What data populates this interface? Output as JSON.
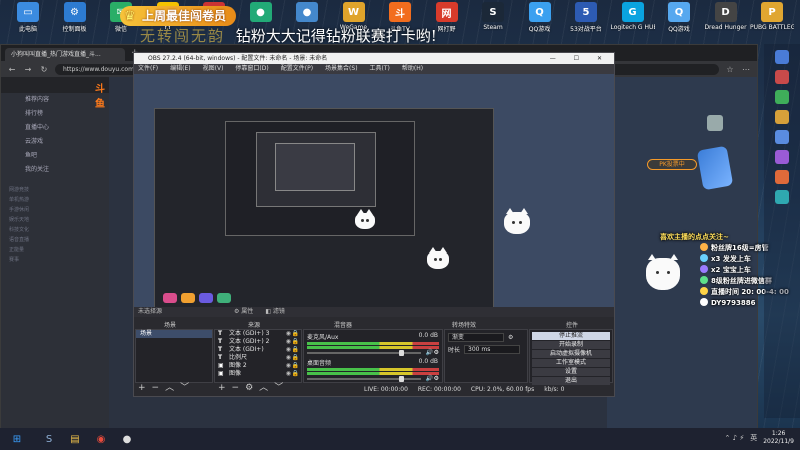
{
  "desktop": {
    "icons": [
      {
        "label": "此电脑",
        "icon": "computer-icon",
        "color": "#3b8be0",
        "glyph": "▭"
      },
      {
        "label": "控制面板",
        "icon": "control-panel-icon",
        "color": "#2d7bd1",
        "glyph": "⚙"
      },
      {
        "label": "微信",
        "icon": "wechat-icon",
        "color": "#2aae67",
        "glyph": "✉"
      },
      {
        "label": "YY",
        "icon": "yy-icon",
        "color": "#f5c200",
        "glyph": "Y"
      },
      {
        "label": "",
        "icon": "app-icon",
        "color": "#c33",
        "glyph": "●"
      },
      {
        "label": "",
        "icon": "app-icon",
        "color": "#2a7",
        "glyph": "●"
      },
      {
        "label": "",
        "icon": "app-icon",
        "color": "#48c",
        "glyph": "●"
      },
      {
        "label": "WeGame",
        "icon": "wegame-icon",
        "color": "#e0a42b",
        "glyph": "W"
      },
      {
        "label": "斗鱼TV",
        "icon": "douyu-icon",
        "color": "#f26d1e",
        "glyph": "斗"
      },
      {
        "label": "网打野",
        "icon": "game-icon",
        "color": "#d83b2b",
        "glyph": "网"
      },
      {
        "label": "Steam",
        "icon": "steam-icon",
        "color": "#1b2838",
        "glyph": "S"
      },
      {
        "label": "QQ游戏",
        "icon": "qq-game-icon",
        "color": "#3ba0f0",
        "glyph": "Q"
      },
      {
        "label": "53对战平台",
        "icon": "battle-platform-icon",
        "color": "#2d5bb3",
        "glyph": "5"
      },
      {
        "label": "Logitech G HUB",
        "icon": "logitech-icon",
        "color": "#0aa3e0",
        "glyph": "G"
      },
      {
        "label": "QQ游戏",
        "icon": "qq-game-icon",
        "color": "#56a8ef",
        "glyph": "Q"
      },
      {
        "label": "Dread Hunger",
        "icon": "dread-hunger-icon",
        "color": "#444",
        "glyph": "D"
      },
      {
        "label": "PUBG BATTLEGR...",
        "icon": "pubg-icon",
        "color": "#e0a631",
        "glyph": "P"
      }
    ]
  },
  "stream_overlay": {
    "banner": "上周最佳闯卷员",
    "ticker_faded": "无转闯无韵",
    "ticker": "钻粉大大记得钻粉联赛打卡哟!",
    "lines": [
      "喜欢主播的点点关注~",
      "粉丝牌16级=房管",
      "x3 发发上车",
      "x2 宝宝上车",
      "8级粉丝牌进微信群",
      "直播时间 20: 00-4: 00",
      "DY9793886"
    ]
  },
  "browser": {
    "tab_title": "小狗叫叫直播_热门游戏直播_斗...",
    "url": "https://www.douyu.com",
    "logo": "斗鱼",
    "sidebar_items": [
      "推荐内容",
      "排行榜",
      "直播中心",
      "云游戏",
      "鱼吧",
      "我的关注"
    ],
    "sidebar_sub": [
      "网游竞技",
      "单机热游",
      "手游休闲",
      "娱乐天地",
      "科技文化",
      "语音直播",
      "正能量",
      "赛事"
    ],
    "pk_button": "PK投票中"
  },
  "obs": {
    "title": "OBS 27.2.4 (64-bit, windows) - 配置文件: 未命名 - 场景: 未命名",
    "menu": [
      "文件(F)",
      "编辑(E)",
      "视图(V)",
      "停靠窗口(D)",
      "配置文件(P)",
      "场景集合(S)",
      "工具(T)",
      "帮助(H)"
    ],
    "toolbar_label": "未选择源",
    "toolbar_items": [
      "属性",
      "滤镜"
    ],
    "docks": [
      "场景",
      "来源",
      "混音器",
      "转场特效",
      "控件"
    ],
    "scenes": [
      "场景"
    ],
    "sources": [
      "文本 (GDI+) 3",
      "文本 (GDI+) 2",
      "文本 (GDI+)",
      "比例尺",
      "图像 2",
      "图像"
    ],
    "mixer": [
      {
        "name": "麦克风/Aux",
        "db": "0.0 dB"
      },
      {
        "name": "桌面音频",
        "db": "0.0 dB"
      }
    ],
    "transition": {
      "type": "渐变",
      "duration_label": "时长",
      "duration": "300 ms"
    },
    "controls": [
      "停止推流",
      "开始录制",
      "启动虚拟摄像机",
      "工作室模式",
      "设置",
      "退出"
    ],
    "status": {
      "live": "LIVE: 00:00:00",
      "rec": "REC: 00:00:00",
      "cpu": "CPU: 2.0%, 60.00 fps",
      "kbps": "kb/s: 0"
    }
  },
  "taskbar": {
    "icons": [
      {
        "icon": "windows-start-icon",
        "glyph": "⊞",
        "color": "#3aa0ff"
      },
      {
        "icon": "steam-icon",
        "glyph": "S",
        "color": "#8fb0d6"
      },
      {
        "icon": "explorer-icon",
        "glyph": "▤",
        "color": "#f2c34a"
      },
      {
        "icon": "chrome-icon",
        "glyph": "◉",
        "color": "#e94b3c"
      },
      {
        "icon": "obs-icon",
        "glyph": "●",
        "color": "#ddd"
      }
    ],
    "time": "1:26",
    "date": "2022/11/9",
    "lang": "英"
  }
}
